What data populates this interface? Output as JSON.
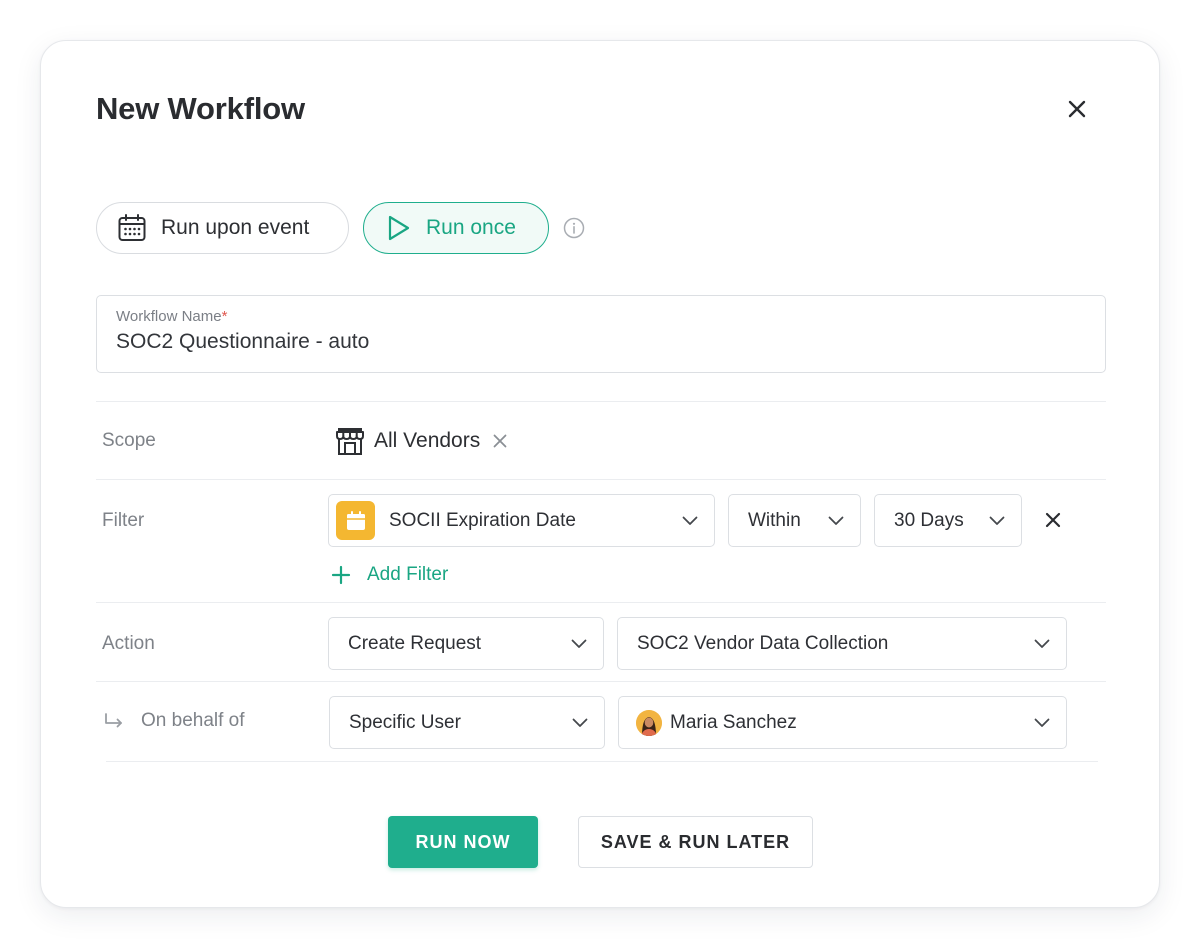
{
  "modal": {
    "title": "New Workflow"
  },
  "modes": {
    "event_label": "Run upon event",
    "once_label": "Run once",
    "selected": "Run once"
  },
  "workflow_name": {
    "label": "Workflow Name",
    "required_mark": "*",
    "value": "SOC2 Questionnaire - auto"
  },
  "scope": {
    "label": "Scope",
    "chip_label": "All Vendors"
  },
  "filter": {
    "label": "Filter",
    "field": "SOCII Expiration Date",
    "operator": "Within",
    "value": "30 Days",
    "add_label": "Add Filter"
  },
  "action": {
    "label": "Action",
    "type": "Create Request",
    "target": "SOC2 Vendor Data Collection"
  },
  "on_behalf": {
    "label": "On behalf of",
    "mode": "Specific User",
    "user": "Maria Sanchez"
  },
  "buttons": {
    "run_now": "RUN NOW",
    "save_later": "SAVE & RUN LATER"
  },
  "colors": {
    "accent": "#1fae8d",
    "calendar_badge": "#f4b731",
    "required": "#e0574f"
  }
}
